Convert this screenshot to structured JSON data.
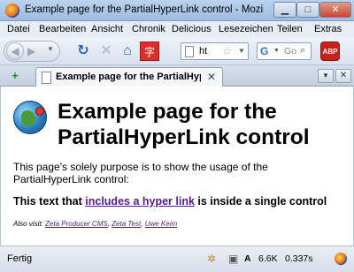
{
  "window": {
    "title": "Example page for the PartialHyperLink control - Mozilla Fire..."
  },
  "menu": [
    "Datei",
    "Bearbeiten",
    "Ansicht",
    "Chronik",
    "Delicious",
    "Lesezeichen",
    "Teilen",
    "Extras"
  ],
  "toolbar": {
    "url_text": "ht",
    "search_placeholder": "Go",
    "search_engine_icon": "G",
    "adblock_label": "ABP",
    "bookmark_icon_text": "字"
  },
  "tabs": [
    {
      "label": "Example page for the PartialHype..."
    }
  ],
  "page": {
    "heading": "Example page for the PartialHyperLink control",
    "intro": "This page's solely purpose is to show the usage of the PartialHyperLink control:",
    "mixed_before": "This text that ",
    "mixed_link": "includes a hyper link",
    "mixed_after": " is inside a single control",
    "also_prefix": "Also visit: ",
    "also_links": [
      "Zeta Producer CMS",
      "Zeta Test",
      "Uwe Keim"
    ]
  },
  "status": {
    "text": "Fertig",
    "size": "6.6K",
    "time": "0.337s",
    "font_indicator": "A"
  },
  "colors": {
    "visited_link": "#551a8b",
    "close_button": "#c6472d",
    "adblock": "#c9201a"
  }
}
